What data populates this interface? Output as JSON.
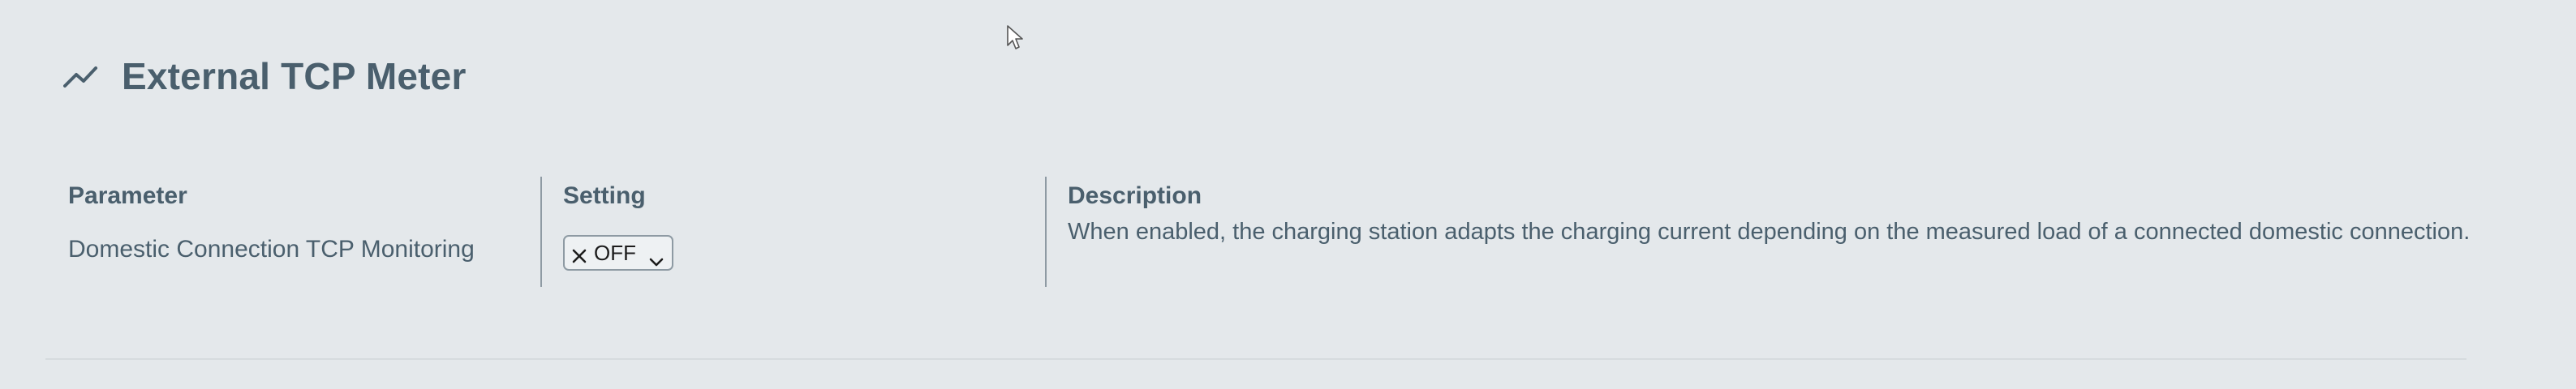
{
  "section": {
    "title": "External TCP Meter",
    "icon": "trend-line-icon"
  },
  "table": {
    "headers": {
      "parameter": "Parameter",
      "setting": "Setting",
      "description": "Description"
    },
    "rows": [
      {
        "parameter": "Domestic Connection TCP Monitoring",
        "setting": {
          "selected": "OFF",
          "icon": "close-icon"
        },
        "description": "When enabled, the charging station adapts the charging current depending on the measured load of a connected domestic connection."
      }
    ]
  }
}
